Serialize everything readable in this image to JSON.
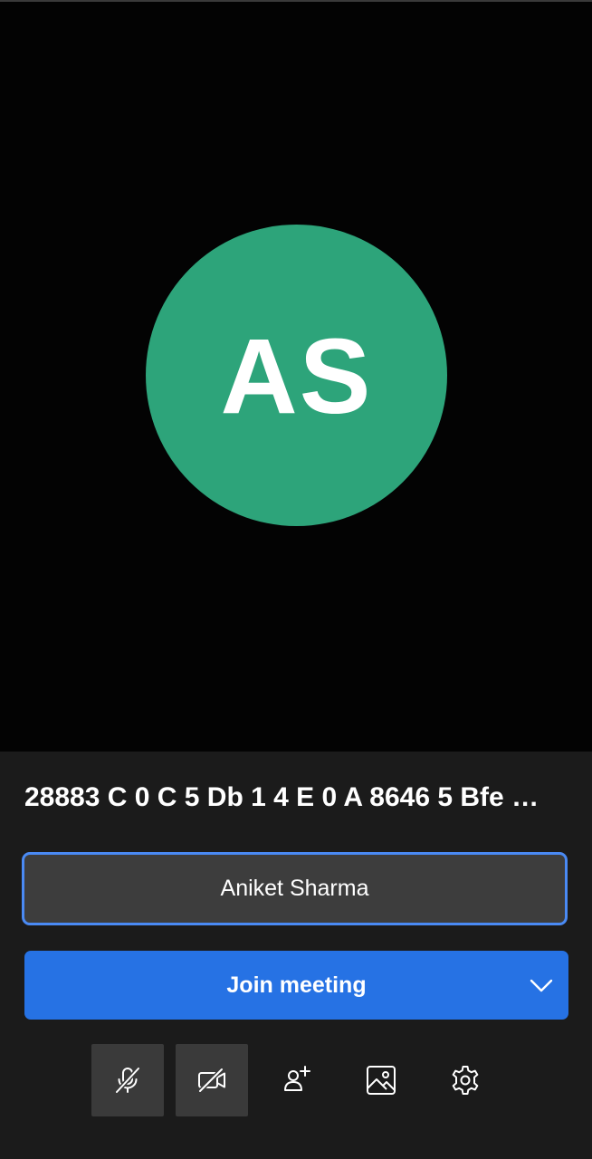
{
  "meeting": {
    "title": "28883 C 0 C 5 Db 1 4 E 0 A 8646 5 Bfe …",
    "avatar_initials": "AS",
    "avatar_color": "#2da47a"
  },
  "name_field": {
    "value": "Aniket Sharma"
  },
  "join": {
    "label": "Join meeting",
    "color": "#2672e4"
  },
  "toolbar": {
    "icons": [
      "microphone-off-icon",
      "video-off-icon",
      "add-person-icon",
      "image-icon",
      "gear-icon"
    ]
  },
  "colors": {
    "panel_background": "#1b1b1b",
    "field_border": "#4a8af4"
  }
}
